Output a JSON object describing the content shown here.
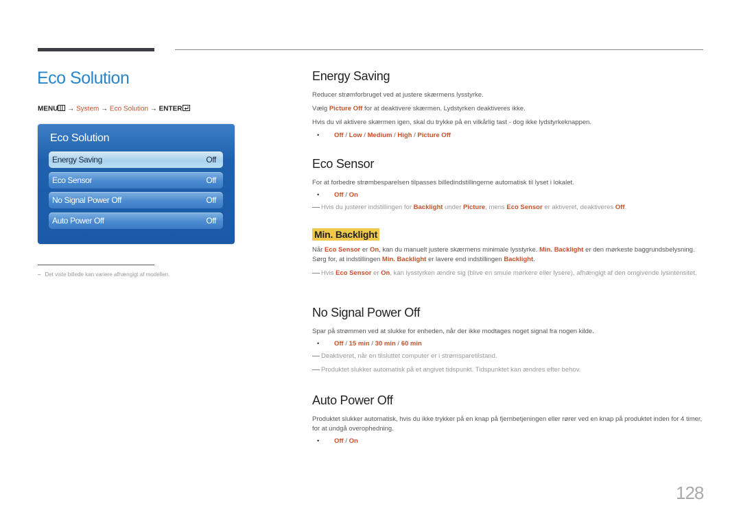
{
  "page": {
    "title": "Eco Solution",
    "page_number": "128"
  },
  "breadcrumb": {
    "menu": "MENU",
    "menu_icon": "menu-grid-icon",
    "arrow": "→",
    "system": "System",
    "eco_solution": "Eco Solution",
    "enter": "ENTER",
    "enter_icon": "enter-icon"
  },
  "panel": {
    "title": "Eco Solution",
    "items": [
      {
        "label": "Energy Saving",
        "value": "Off",
        "selected": true
      },
      {
        "label": "Eco Sensor",
        "value": "Off",
        "selected": false
      },
      {
        "label": "No Signal Power Off",
        "value": "Off",
        "selected": false
      },
      {
        "label": "Auto Power Off",
        "value": "Off",
        "selected": false
      }
    ]
  },
  "footnote": {
    "dash": "–",
    "text": "Det viste billede kan variere afhængigt af modellen."
  },
  "energy_saving": {
    "heading": "Energy Saving",
    "p1": "Reducer strømforbruget ved at justere skærmens lysstyrke.",
    "p2_a": "Vælg ",
    "p2_b": "Picture Off",
    "p2_c": " for at deaktivere skærmen. Lydstyrken deaktiveres ikke.",
    "p3": "Hvis du vil aktivere skærmen igen, skal du trykke på en vilkårlig tast - dog ikke lydstyrkeknappen.",
    "options": [
      "Off",
      "Low",
      "Medium",
      "High",
      "Picture Off"
    ]
  },
  "eco_sensor": {
    "heading": "Eco Sensor",
    "p1": "For at forbedre strømbesparelsen tilpasses billedindstillingerne automatisk til lyset i lokalet.",
    "options": [
      "Off",
      "On"
    ],
    "note_a": "Hvis du justerer indstillingen for ",
    "note_b": "Backlight",
    "note_c": " under ",
    "note_d": "Picture",
    "note_e": ", mens ",
    "note_f": "Eco Sensor",
    "note_g": " er aktiveret, deaktiveres ",
    "note_h": "Off",
    "note_i": "."
  },
  "min_backlight": {
    "heading": "Min. Backlight",
    "p_a": "Når ",
    "p_b": "Eco Sensor",
    "p_c": " er ",
    "p_d": "On",
    "p_e": ", kan du manuelt justere skærmens minimale lysstyrke. ",
    "p_f": "Min. Backlight",
    "p_g": " er den mørkeste baggrundsbelysning. Sørg for, at indstillingen ",
    "p_h": "Min. Backlight",
    "p_i": " er lavere end indstillingen ",
    "p_j": "Backlight",
    "p_k": ".",
    "note_a": "Hvis ",
    "note_b": "Eco Sensor",
    "note_c": " er ",
    "note_d": "On",
    "note_e": ", kan lysstyrken ændre sig (blive en smule mørkere eller lysere), afhængigt af den omgivende lysintensitet."
  },
  "no_signal": {
    "heading": "No Signal Power Off",
    "p1": "Spar på strømmen ved at slukke for enheden, når der ikke modtages noget signal fra nogen kilde.",
    "options": [
      "Off",
      "15 min",
      "30 min",
      "60 min"
    ],
    "note1": "Deaktiveret, når en tilsluttet computer er i strømsparetilstand.",
    "note2": "Produktet slukker automatisk på et angivet tidspunkt. Tidspunktet kan ændres efter behov."
  },
  "auto_power": {
    "heading": "Auto Power Off",
    "p1": "Produktet slukker automatisk, hvis du ikke trykker på en knap på fjernbetjeningen eller rører ved en knap på produktet inden for 4 timer, for at undgå overophedning.",
    "options": [
      "Off",
      "On"
    ]
  },
  "separator": " / ",
  "bullet": "•"
}
